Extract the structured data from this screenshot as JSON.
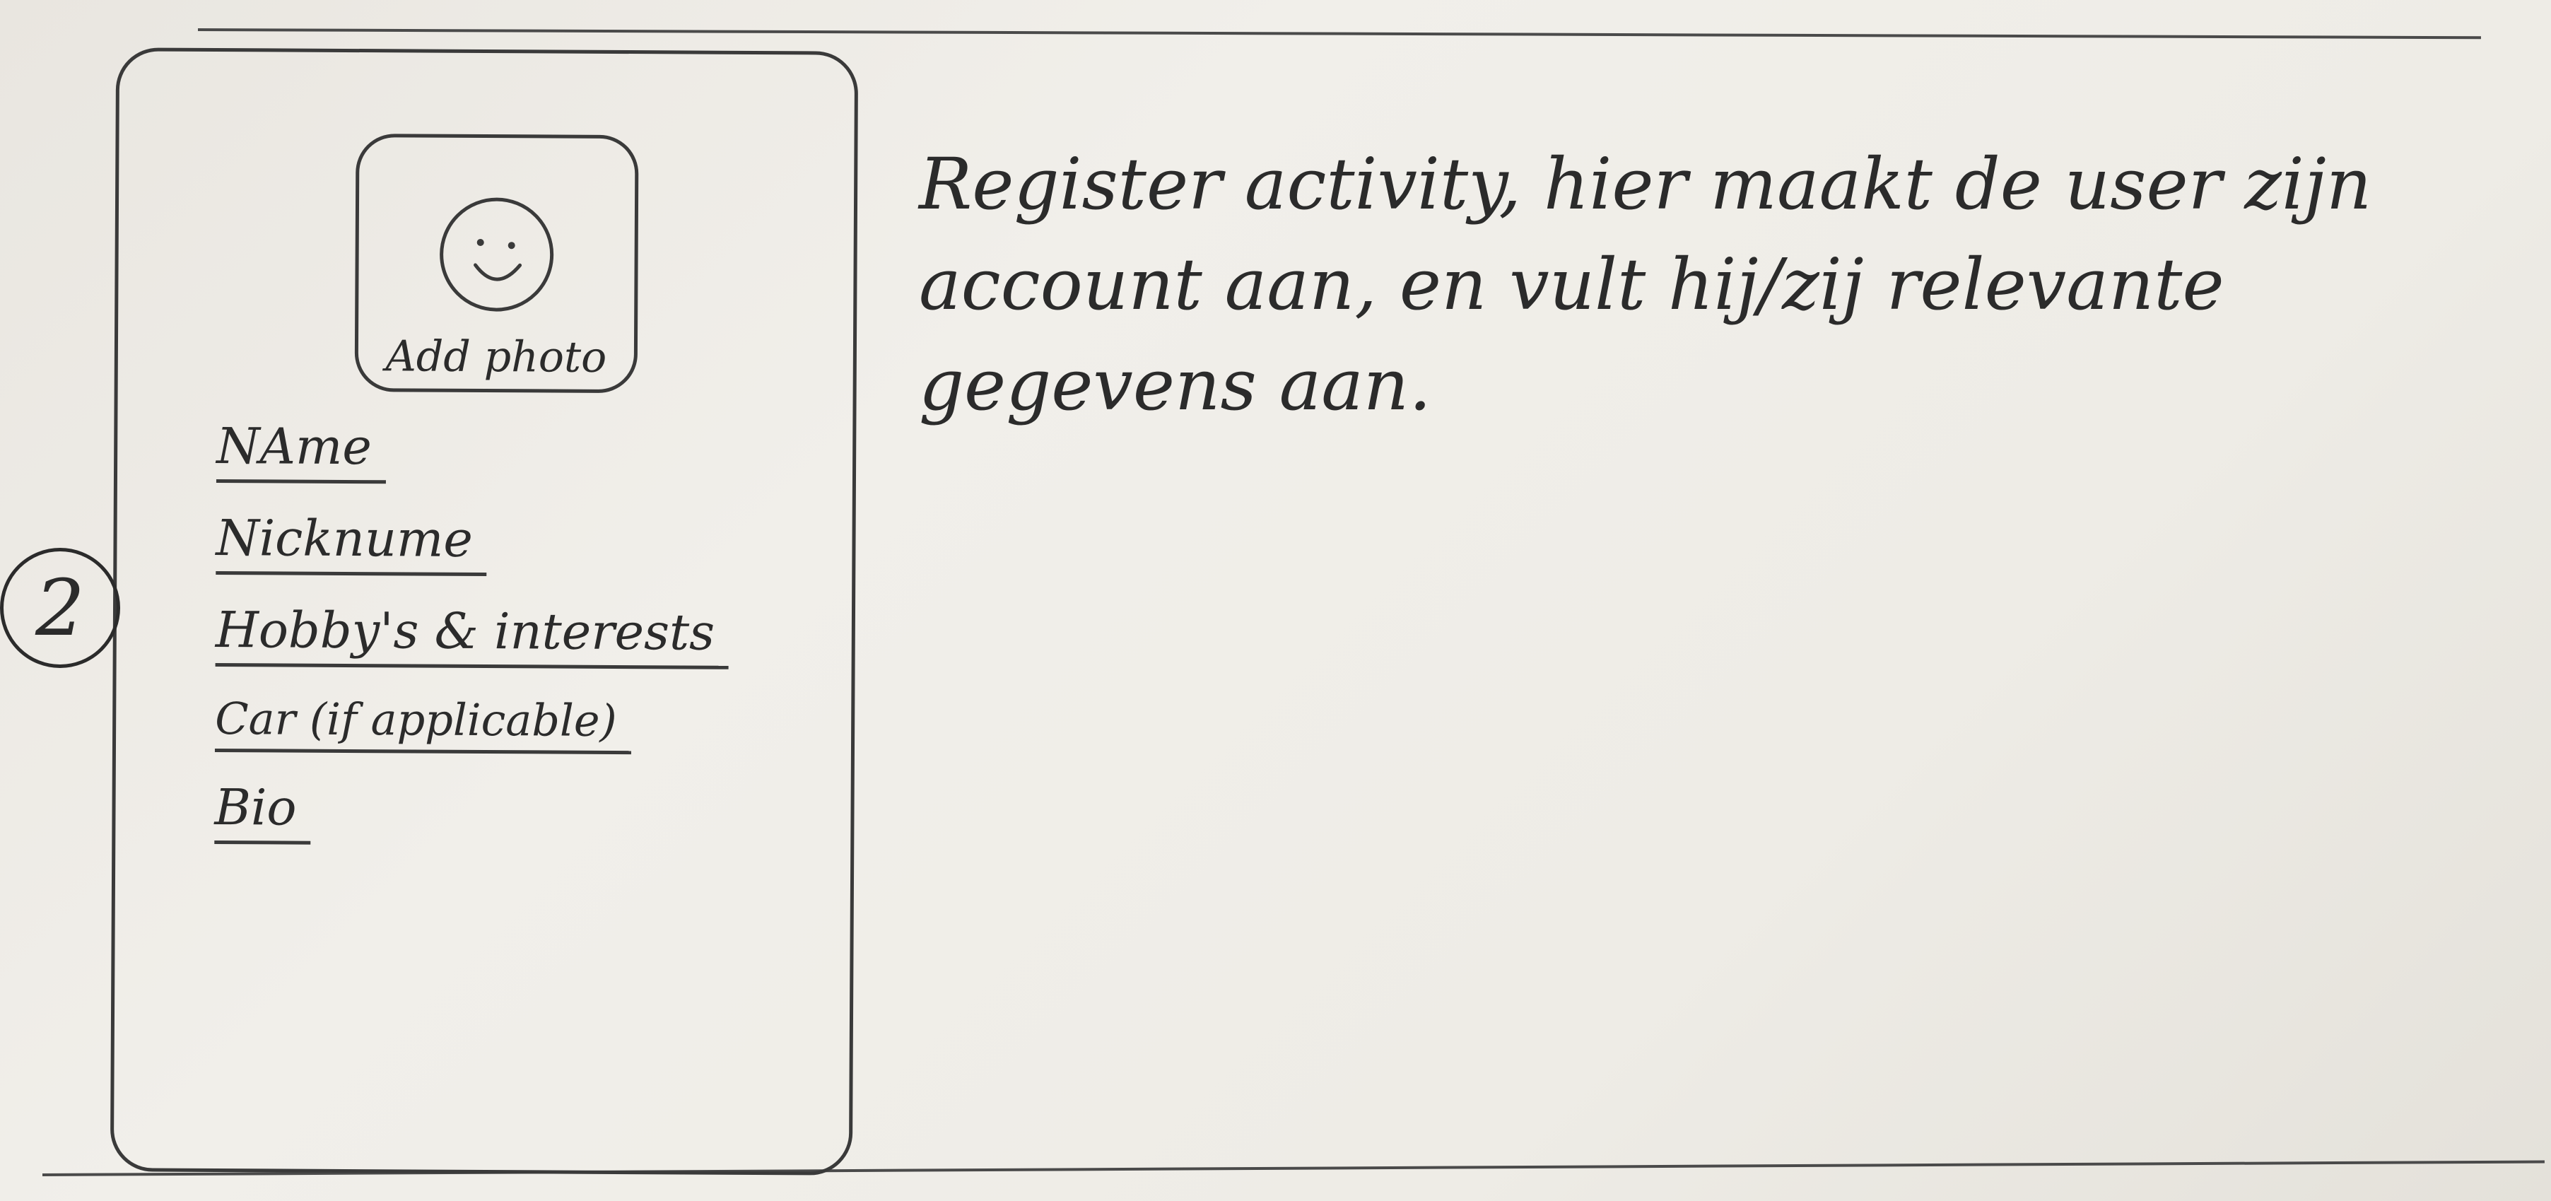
{
  "sketch": {
    "photo_label": "Add photo",
    "step_number": "2",
    "fields": [
      {
        "label": "NAme"
      },
      {
        "label": "Nicknume"
      },
      {
        "label": "Hobby's & interests"
      },
      {
        "label": "Car (if applicable)"
      },
      {
        "label": "Bio"
      }
    ],
    "note": "Register activity, hier maakt de user zijn account aan, en vult hij/zij relevante gegevens aan."
  }
}
